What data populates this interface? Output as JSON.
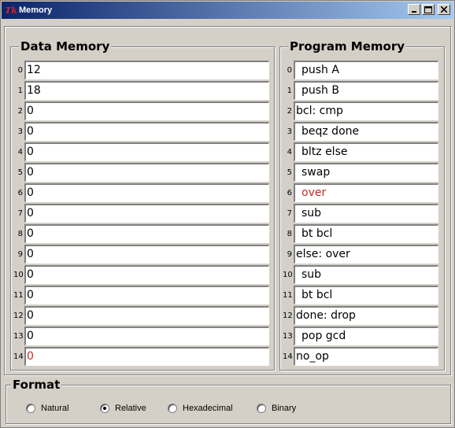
{
  "window": {
    "title": "Memory",
    "app_icon_text": "Tk"
  },
  "data_memory": {
    "label": "Data Memory",
    "rows": [
      {
        "index": "0",
        "value": "12",
        "highlight": false
      },
      {
        "index": "1",
        "value": "18",
        "highlight": false
      },
      {
        "index": "2",
        "value": "0",
        "highlight": false
      },
      {
        "index": "3",
        "value": "0",
        "highlight": false
      },
      {
        "index": "4",
        "value": "0",
        "highlight": false
      },
      {
        "index": "5",
        "value": "0",
        "highlight": false
      },
      {
        "index": "6",
        "value": "0",
        "highlight": false
      },
      {
        "index": "7",
        "value": "0",
        "highlight": false
      },
      {
        "index": "8",
        "value": "0",
        "highlight": false
      },
      {
        "index": "9",
        "value": "0",
        "highlight": false
      },
      {
        "index": "10",
        "value": "0",
        "highlight": false
      },
      {
        "index": "11",
        "value": "0",
        "highlight": false
      },
      {
        "index": "12",
        "value": "0",
        "highlight": false
      },
      {
        "index": "13",
        "value": "0",
        "highlight": false
      },
      {
        "index": "14",
        "value": "0",
        "highlight": true
      }
    ]
  },
  "program_memory": {
    "label": "Program Memory",
    "rows": [
      {
        "index": "0",
        "value": "push A",
        "indent": true,
        "highlight": false
      },
      {
        "index": "1",
        "value": "push B",
        "indent": true,
        "highlight": false
      },
      {
        "index": "2",
        "value": "bcl: cmp",
        "indent": false,
        "highlight": false
      },
      {
        "index": "3",
        "value": "beqz done",
        "indent": true,
        "highlight": false
      },
      {
        "index": "4",
        "value": "bltz else",
        "indent": true,
        "highlight": false
      },
      {
        "index": "5",
        "value": "swap",
        "indent": true,
        "highlight": false
      },
      {
        "index": "6",
        "value": "over",
        "indent": true,
        "highlight": true
      },
      {
        "index": "7",
        "value": "sub",
        "indent": true,
        "highlight": false
      },
      {
        "index": "8",
        "value": "bt bcl",
        "indent": true,
        "highlight": false
      },
      {
        "index": "9",
        "value": "else: over",
        "indent": false,
        "highlight": false
      },
      {
        "index": "10",
        "value": "sub",
        "indent": true,
        "highlight": false
      },
      {
        "index": "11",
        "value": "bt bcl",
        "indent": true,
        "highlight": false
      },
      {
        "index": "12",
        "value": "done: drop",
        "indent": false,
        "highlight": false
      },
      {
        "index": "13",
        "value": "pop gcd",
        "indent": true,
        "highlight": false
      },
      {
        "index": "14",
        "value": "no_op",
        "indent": false,
        "highlight": false
      }
    ]
  },
  "format": {
    "label": "Format",
    "options": [
      {
        "label": "Natural",
        "checked": false
      },
      {
        "label": "Relative",
        "checked": true
      },
      {
        "label": "Hexadecimal",
        "checked": false
      },
      {
        "label": "Binary",
        "checked": false
      }
    ]
  },
  "colors": {
    "highlight_text": "#c0282a",
    "titlebar_start": "#0a246a",
    "titlebar_end": "#a6caf0",
    "window_bg": "#d4d0c8"
  }
}
